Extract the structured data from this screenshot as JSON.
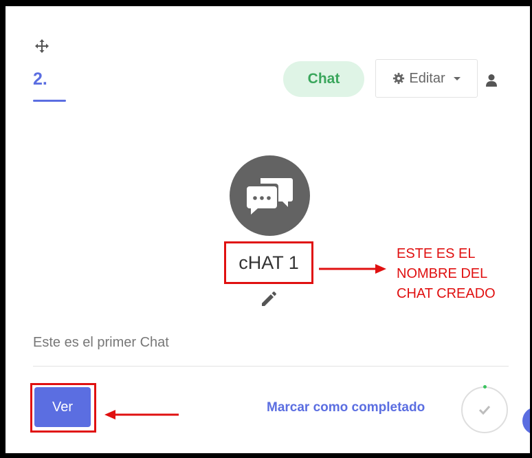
{
  "card": {
    "number": "2.",
    "type_badge": "Chat",
    "edit_label": "Editar",
    "item_name": "cHAT 1",
    "description": "Este es el primer Chat",
    "view_button": "Ver",
    "mark_complete": "Marcar como completado"
  },
  "annotation": {
    "lines": [
      "ESTE ES EL",
      "NOMBRE DEL",
      "CHAT CREADO"
    ]
  },
  "icons": {
    "move": "move-arrows-icon",
    "gear": "gear-icon",
    "caret": "caret-down-icon",
    "user": "user-icon",
    "chat": "chat-bubbles-icon",
    "pencil": "pencil-icon",
    "check": "check-icon"
  },
  "colors": {
    "accent": "#5b6ee1",
    "badge_bg": "#dff4e6",
    "badge_text": "#3aa65c",
    "annotation_red": "#e01010",
    "chat_circle": "#636363"
  }
}
